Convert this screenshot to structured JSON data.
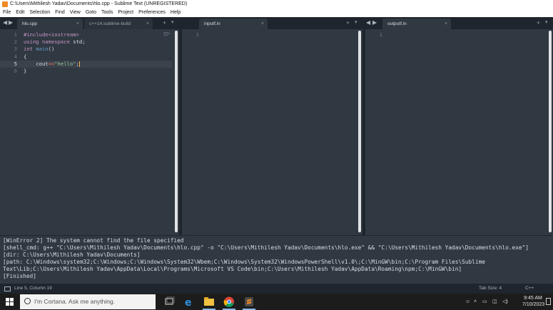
{
  "window": {
    "title": "C:\\Users\\Mithilesh Yadav\\Documents\\hlo.cpp - Sublime Text (UNREGISTERED)"
  },
  "menu": [
    "File",
    "Edit",
    "Selection",
    "Find",
    "View",
    "Goto",
    "Tools",
    "Project",
    "Preferences",
    "Help"
  ],
  "panes": [
    {
      "tabs": [
        {
          "label": "hlo.cpp",
          "active": true
        },
        {
          "label": "c++14.sublime-build",
          "active": false
        }
      ],
      "code": [
        [
          {
            "t": "#include<iostream>",
            "c": "pp"
          }
        ],
        [
          {
            "t": "using namespace",
            "c": "kw"
          },
          {
            "t": " std;",
            "c": "punct"
          }
        ],
        [
          {
            "t": "int",
            "c": "ty"
          },
          {
            "t": " ",
            "c": "punct"
          },
          {
            "t": "main",
            "c": "fn"
          },
          {
            "t": "()",
            "c": "punct"
          }
        ],
        [
          {
            "t": "{",
            "c": "punct"
          }
        ],
        [
          {
            "t": "    cout",
            "c": "punct"
          },
          {
            "t": "<<",
            "c": "op"
          },
          {
            "t": "\"hello\"",
            "c": "str"
          },
          {
            "t": ";",
            "c": "punct"
          }
        ],
        [
          {
            "t": "}",
            "c": "punct"
          }
        ]
      ],
      "line_numbers": [
        "1",
        "2",
        "3",
        "4",
        "5",
        "6"
      ],
      "current_line": 5
    },
    {
      "tabs": [
        {
          "label": "inputf.in",
          "active": true
        }
      ],
      "line_numbers": [
        "1"
      ]
    },
    {
      "tabs": [
        {
          "label": "outputf.in",
          "active": true
        }
      ],
      "line_numbers": [
        "1"
      ]
    }
  ],
  "output_panel": {
    "lines": [
      "[WinError 2] The system cannot find the file specified",
      "[shell_cmd: g++ \"C:\\Users\\Mithilesh Yadav\\Documents\\hlo.cpp\" -o \"C:\\Users\\Mithilesh Yadav\\Documents\\hlo.exe\" && \"C:\\Users\\Mithilesh Yadav\\Documents\\hlo.exe\"]",
      "[dir: C:\\Users\\Mithilesh Yadav\\Documents]",
      "[path: C:\\Windows\\system32;C:\\Windows;C:\\Windows\\System32\\Wbem;C:\\Windows\\System32\\WindowsPowerShell\\v1.0\\;C:\\MinGW\\bin;C:\\Program Files\\Sublime",
      "Text\\Lib;C:\\Users\\Mithilesh Yadav\\AppData\\Local\\Programs\\Microsoft VS Code\\bin;C:\\Users\\Mithilesh Yadav\\AppData\\Roaming\\npm;C:\\MinGW\\bin]",
      "[Finished]"
    ]
  },
  "status_bar": {
    "position": "Line 5, Column 19",
    "tab_size": "Tab Size: 4",
    "syntax": "C++"
  },
  "taskbar": {
    "search_placeholder": "I'm Cortana. Ask me anything.",
    "time": "9:45 AM",
    "date": "7/10/2023",
    "apps": [
      "task-view-icon",
      "edge-icon",
      "file-explorer-icon",
      "chrome-icon",
      "sublime-text-icon"
    ]
  },
  "colors": {
    "editor_bg": "#303841",
    "string": "#99c794",
    "keyword": "#c594c5",
    "operator": "#f97b58"
  }
}
